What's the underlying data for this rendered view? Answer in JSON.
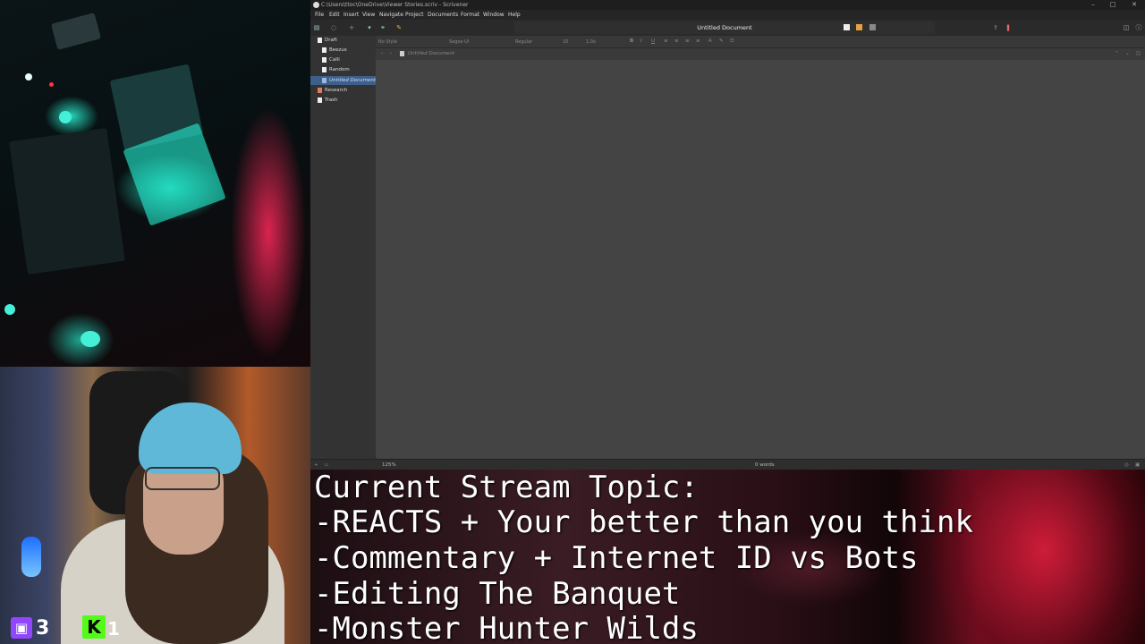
{
  "window": {
    "title": "C:\\Users\\ttoc\\OneDrive\\Viewer Stories.scriv - Scrivener",
    "controls": [
      "–",
      "□",
      "✕"
    ]
  },
  "menu": [
    "File",
    "Edit",
    "Insert",
    "View",
    "Navigate",
    "Project",
    "Documents",
    "Format",
    "Window",
    "Help"
  ],
  "editor_tab_title": "Untitled Document",
  "binder": {
    "items": [
      {
        "label": "Draft",
        "level": 0,
        "selected": false
      },
      {
        "label": "Beezus",
        "level": 1,
        "selected": false
      },
      {
        "label": "Calli",
        "level": 1,
        "selected": false
      },
      {
        "label": "Random",
        "level": 1,
        "selected": false
      },
      {
        "label": "Untitled Document",
        "level": 1,
        "selected": true
      },
      {
        "label": "Research",
        "level": 0,
        "selected": false
      },
      {
        "label": "Trash",
        "level": 0,
        "selected": false
      }
    ]
  },
  "format_bar": {
    "style": "No Style",
    "font": "Segoe UI",
    "weight": "Regular",
    "size": "10",
    "line_spacing": "1.0x",
    "buttons": [
      "B",
      "I",
      "U"
    ]
  },
  "header": {
    "document": "Untitled Document"
  },
  "footer": {
    "zoom": "125%",
    "word_count": "0 words"
  },
  "stream": {
    "topic_lines": [
      "Current Stream Topic:",
      "-REACTS + Your better than you think",
      "-Commentary + Internet ID vs Bots",
      "-Editing The Banquet",
      "-Monster Hunter Wilds"
    ],
    "twitch_viewers": "3",
    "kick_viewers": "1",
    "twitch_color": "#9146ff",
    "kick_color": "#53fc18"
  }
}
